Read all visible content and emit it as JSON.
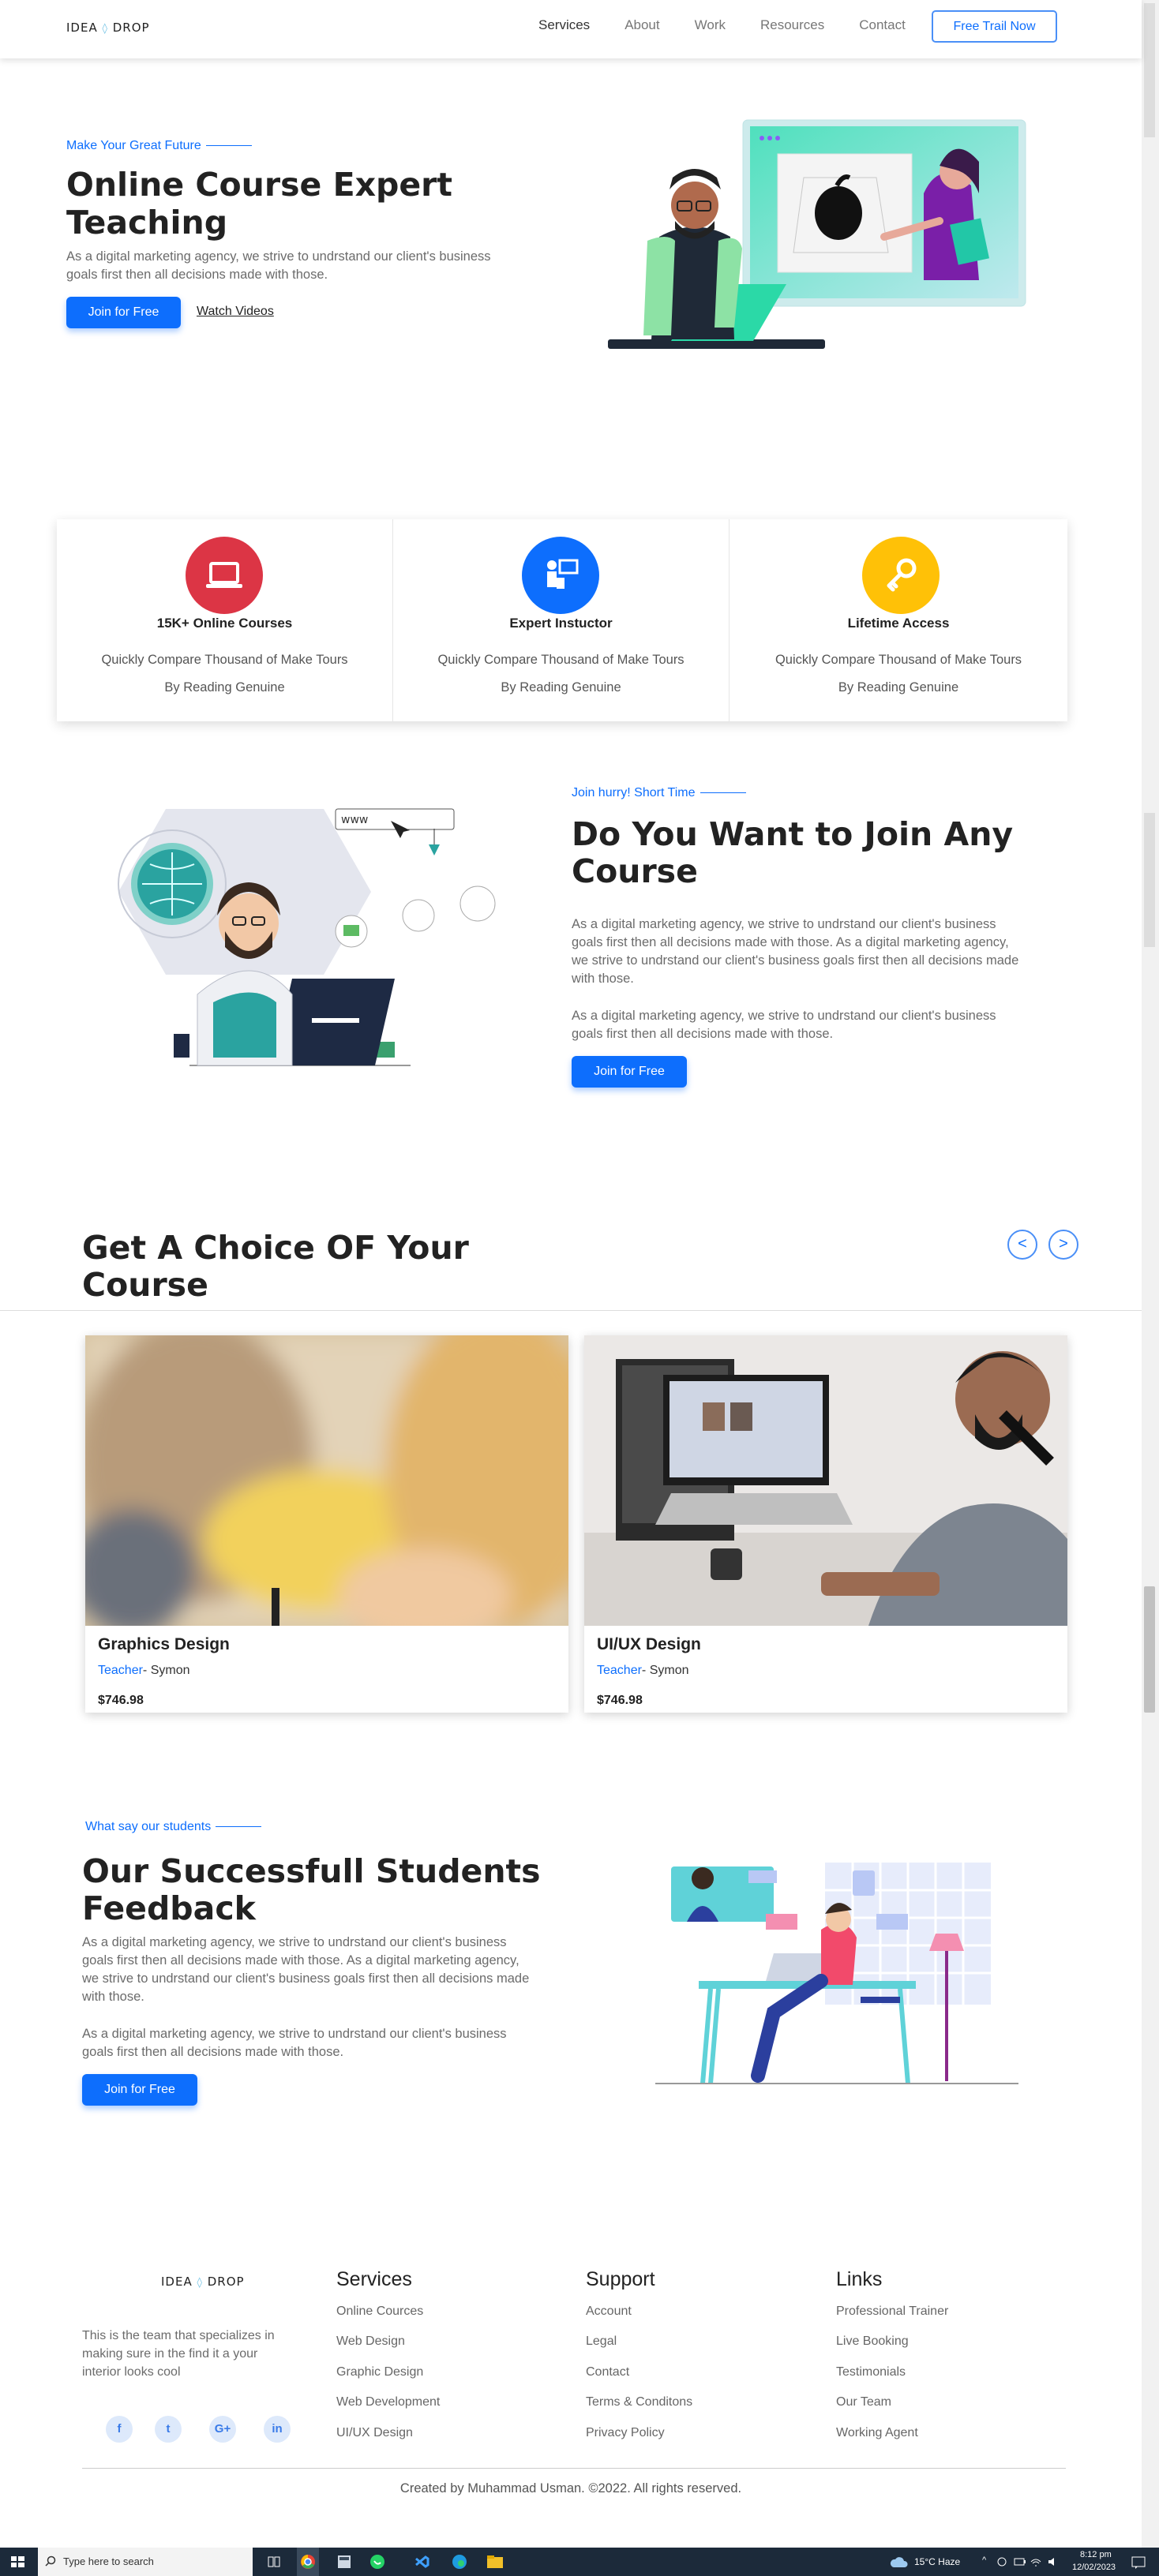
{
  "nav": {
    "logo_a": "IDEA",
    "logo_b": "DROP",
    "links": [
      "Services",
      "About",
      "Work",
      "Resources",
      "Contact"
    ],
    "cta": "Free Trail Now"
  },
  "hero": {
    "subtitle": "Make Your Great Future",
    "title_line1": "Online Course Expert",
    "title_line2": "Teaching",
    "desc_line1": "As a digital marketing agency, we strive to undrstand our client's business",
    "desc_line2": "goals first then all decisions made with those.",
    "primary_btn": "Join for Free",
    "secondary_link": "Watch Videos"
  },
  "features": [
    {
      "title": "15K+ Online Courses",
      "line1": "Quickly Compare Thousand of Make Tours",
      "line2": "By Reading Genuine",
      "color": "#dc3545",
      "icon": "laptop-icon"
    },
    {
      "title": "Expert Instuctor",
      "line1": "Quickly Compare Thousand of Make Tours",
      "line2": "By Reading Genuine",
      "color": "#0d6efd",
      "icon": "instructor-icon"
    },
    {
      "title": "Lifetime Access",
      "line1": "Quickly Compare Thousand of Make Tours",
      "line2": "By Reading Genuine",
      "color": "#ffc107",
      "icon": "key-icon"
    }
  ],
  "join": {
    "subtitle": "Join hurry! Short Time",
    "title_line1": "Do You Want to Join Any",
    "title_line2": "Course",
    "p1": [
      "As a digital marketing agency, we strive to undrstand our client's business",
      "goals first then all decisions made with those. As a digital marketing agency,",
      "we strive to undrstand our client's business goals first then all decisions made",
      "with those."
    ],
    "p2": [
      "As a digital marketing agency, we strive to undrstand our client's business",
      "goals first then all decisions made with those."
    ],
    "btn": "Join for Free"
  },
  "courses": {
    "title_line1": "Get A Choice OF Your",
    "title_line2": "Course",
    "prev": "<",
    "next": ">",
    "items": [
      {
        "title": "Graphics Design",
        "teacher_label": "Teacher",
        "teacher": "- Symon",
        "price": "$746.98"
      },
      {
        "title": "UI/UX Design",
        "teacher_label": "Teacher",
        "teacher": "- Symon",
        "price": "$746.98"
      }
    ]
  },
  "feedback": {
    "subtitle": "What say our students",
    "title_line1": "Our Successfull Students",
    "title_line2": "Feedback",
    "p1": [
      "As a digital marketing agency, we strive to undrstand our client's business",
      "goals first then all decisions made with those. As a digital marketing agency,",
      "we strive to undrstand our client's business goals first then all decisions made",
      "with those."
    ],
    "p2": [
      "As a digital marketing agency, we strive to undrstand our client's business",
      "goals first then all decisions made with those."
    ],
    "btn": "Join for Free"
  },
  "footer": {
    "about": [
      "This is the team that specializes in",
      "making sure in the find it a your",
      "interior looks cool"
    ],
    "social": [
      "f",
      "t",
      "G+",
      "in"
    ],
    "columns": [
      {
        "heading": "Services",
        "links": [
          "Online Cources",
          "Web Design",
          "Graphic Design",
          "Web Development",
          "UI/UX Design"
        ]
      },
      {
        "heading": "Support",
        "links": [
          "Account",
          "Legal",
          "Contact",
          "Terms & Conditons",
          "Privacy Policy"
        ]
      },
      {
        "heading": "Links",
        "links": [
          "Professional Trainer",
          "Live Booking",
          "Testimonials",
          "Our Team",
          "Working Agent"
        ]
      }
    ],
    "copyright": "Created by Muhammad Usman. ©2022. All rights reserved."
  },
  "taskbar": {
    "search_placeholder": "Type here to search",
    "weather": "15°C  Haze",
    "time": "8:12 pm",
    "date": "12/02/2023"
  }
}
